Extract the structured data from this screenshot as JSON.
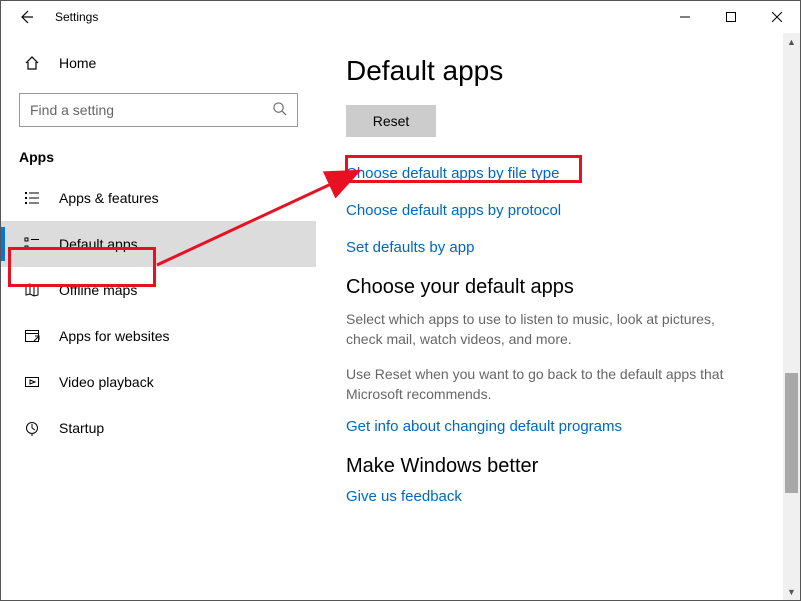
{
  "titlebar": {
    "title": "Settings"
  },
  "sidebar": {
    "home": "Home",
    "search_placeholder": "Find a setting",
    "section": "Apps",
    "items": [
      {
        "label": "Apps & features"
      },
      {
        "label": "Default apps"
      },
      {
        "label": "Offline maps"
      },
      {
        "label": "Apps for websites"
      },
      {
        "label": "Video playback"
      },
      {
        "label": "Startup"
      }
    ]
  },
  "main": {
    "title": "Default apps",
    "reset": "Reset",
    "link_filetype": "Choose default apps by file type",
    "link_protocol": "Choose default apps by protocol",
    "link_setdefaults": "Set defaults by app",
    "choose_heading": "Choose your default apps",
    "choose_body1": "Select which apps to use to listen to music, look at pictures, check mail, watch videos, and more.",
    "choose_body2": "Use Reset when you want to go back to the default apps that Microsoft recommends.",
    "link_getinfo": "Get info about changing default programs",
    "better_heading": "Make Windows better",
    "link_feedback": "Give us feedback"
  }
}
